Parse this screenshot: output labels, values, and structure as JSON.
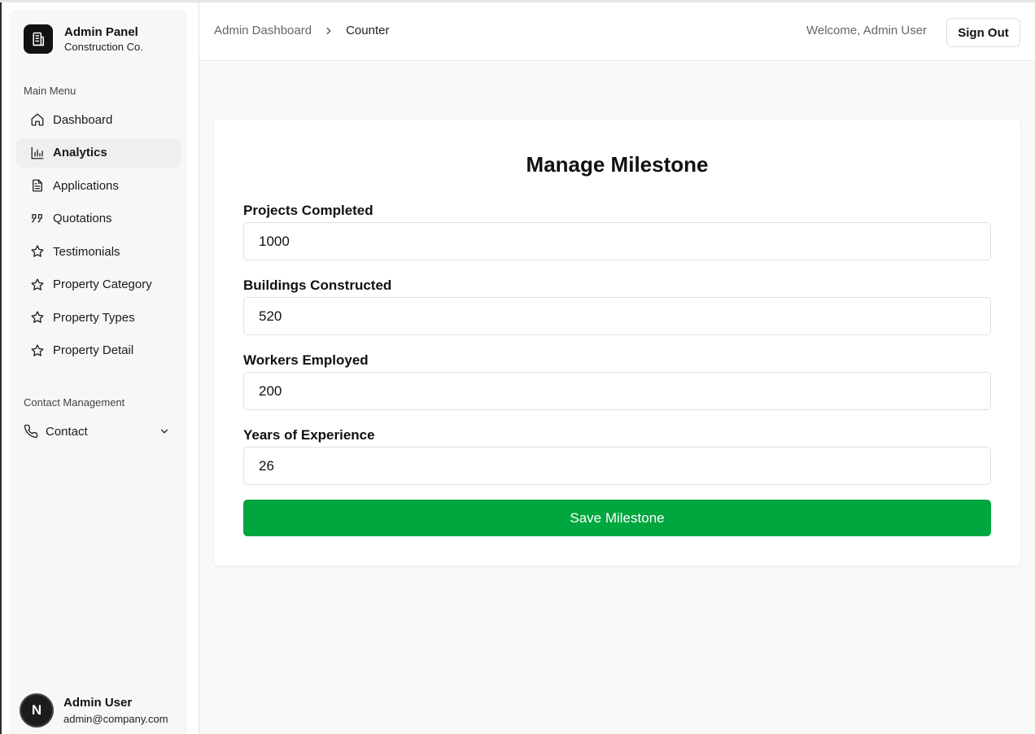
{
  "brand": {
    "title": "Admin Panel",
    "subtitle": "Construction Co."
  },
  "sidebar": {
    "main_menu_label": "Main Menu",
    "items": [
      {
        "label": "Dashboard",
        "icon": "home-icon"
      },
      {
        "label": "Analytics",
        "icon": "bar-chart-icon",
        "active": true
      },
      {
        "label": "Applications",
        "icon": "document-icon"
      },
      {
        "label": "Quotations",
        "icon": "quote-icon"
      },
      {
        "label": "Testimonials",
        "icon": "star-icon"
      },
      {
        "label": "Property Category",
        "icon": "star-icon"
      },
      {
        "label": "Property Types",
        "icon": "star-icon"
      },
      {
        "label": "Property Detail",
        "icon": "star-icon"
      }
    ],
    "contact_section_label": "Contact Management",
    "contact_label": "Contact"
  },
  "user": {
    "initial": "N",
    "name": "Admin User",
    "email": "admin@company.com"
  },
  "topbar": {
    "breadcrumb_root": "Admin Dashboard",
    "breadcrumb_current": "Counter",
    "welcome": "Welcome, Admin User",
    "sign_out": "Sign Out"
  },
  "form": {
    "title": "Manage Milestone",
    "fields": [
      {
        "label": "Projects Completed",
        "value": "1000"
      },
      {
        "label": "Buildings Constructed",
        "value": "520"
      },
      {
        "label": "Workers Employed",
        "value": "200"
      },
      {
        "label": "Years of Experience",
        "value": "26"
      }
    ],
    "save_label": "Save Milestone"
  },
  "colors": {
    "accent_green": "#00a63e",
    "brand_dark": "#111111"
  }
}
